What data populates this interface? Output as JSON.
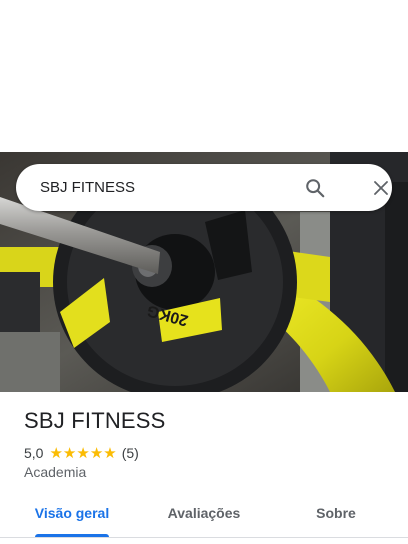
{
  "search": {
    "value": "SBJ FITNESS",
    "search_icon": "search-icon",
    "close_icon": "close-icon"
  },
  "place": {
    "title": "SBJ FITNESS",
    "rating": "5,0",
    "rating_value": 5.0,
    "stars": [
      "★",
      "★",
      "★",
      "★",
      "★"
    ],
    "review_count": "(5)",
    "category": "Academia"
  },
  "photo": {
    "plate_label": "20KG"
  },
  "tabs": [
    {
      "label": "Visão geral",
      "active": true
    },
    {
      "label": "Avaliações",
      "active": false
    },
    {
      "label": "Sobre",
      "active": false
    }
  ],
  "colors": {
    "accent": "#1a73e8",
    "star": "#fbbc04",
    "plate_yellow": "#e9e51a"
  }
}
